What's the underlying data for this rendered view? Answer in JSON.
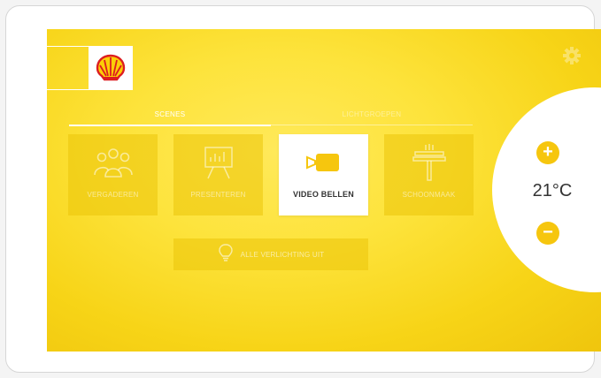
{
  "header": {
    "logo": "shell-logo",
    "settings_icon": "gear-icon"
  },
  "tabs": [
    {
      "label": "SCENES",
      "active": true
    },
    {
      "label": "LICHTGROEPEN",
      "active": false
    }
  ],
  "scenes": [
    {
      "label": "VERGADEREN",
      "icon": "people-icon",
      "active": false
    },
    {
      "label": "PRESENTEREN",
      "icon": "presentation-board-icon",
      "active": false
    },
    {
      "label": "VIDEO BELLEN",
      "icon": "video-camera-icon",
      "active": true
    },
    {
      "label": "SCHOONMAAK",
      "icon": "squeegee-icon",
      "active": false
    }
  ],
  "all_lights_off": {
    "label": "ALLE VERLICHTING UIT",
    "icon": "lightbulb-icon"
  },
  "thermostat": {
    "temperature": "21°C",
    "increase_icon": "plus-icon",
    "decrease_icon": "minus-icon"
  },
  "colors": {
    "accent": "#f6c60e",
    "background": "#fde33b",
    "shell_red": "#dd1d21",
    "shell_yellow": "#fbce07"
  }
}
